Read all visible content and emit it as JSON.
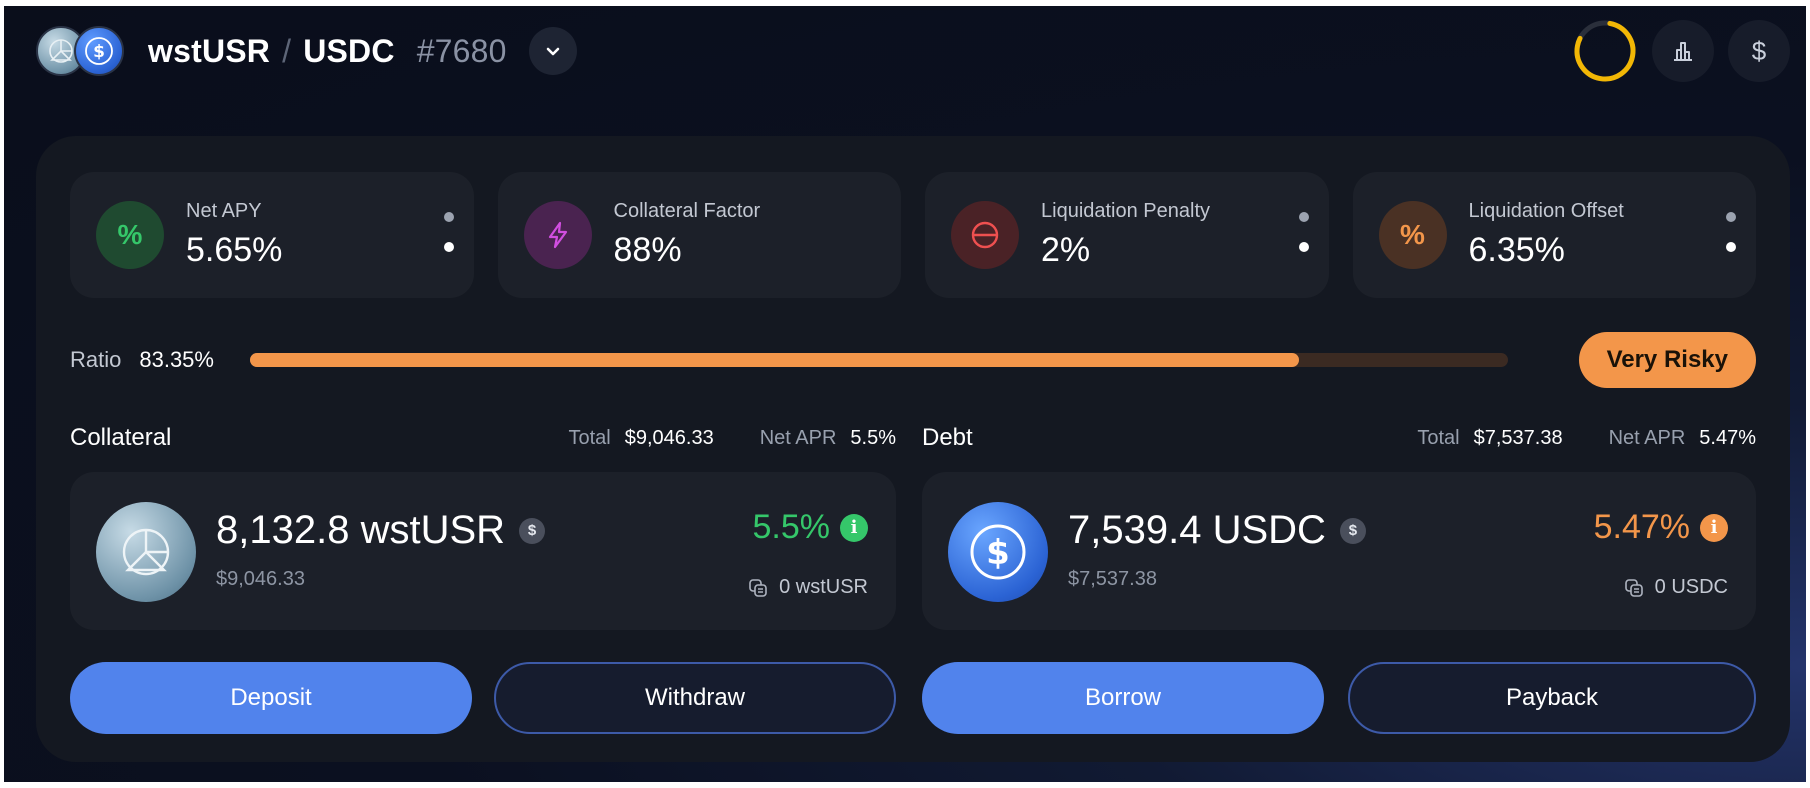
{
  "header": {
    "base_token": "wstUSR",
    "separator": "/",
    "quote_token": "USDC",
    "position_id": "#7680"
  },
  "stats": [
    {
      "label": "Net APY",
      "value": "5.65%",
      "icon": "percent-icon",
      "icon_color": "#35c76a",
      "icon_bg": "#1f4a30",
      "glyph": "%"
    },
    {
      "label": "Collateral Factor",
      "value": "88%",
      "icon": "lightning-icon",
      "icon_color": "#d14ee0",
      "icon_bg": "#4a2350"
    },
    {
      "label": "Liquidation Penalty",
      "value": "2%",
      "icon": "minus-circle-icon",
      "icon_color": "#ef5050",
      "icon_bg": "#4a2226"
    },
    {
      "label": "Liquidation Offset",
      "value": "6.35%",
      "icon": "percent-icon",
      "icon_color": "#f3964a",
      "icon_bg": "#4a3124",
      "glyph": "%"
    }
  ],
  "ratio": {
    "label": "Ratio",
    "value": "83.35%",
    "fill_fraction": 0.8335,
    "risk_label": "Very Risky",
    "risk_color": "#f3964a"
  },
  "collateral": {
    "title": "Collateral",
    "total_label": "Total",
    "total_value": "$9,046.33",
    "apr_label": "Net APR",
    "apr_value": "5.5%",
    "amount": "8,132.8 wstUSR",
    "usd": "$9,046.33",
    "rate": "5.5%",
    "rate_color": "#35c76a",
    "balance": "0 wstUSR"
  },
  "debt": {
    "title": "Debt",
    "total_label": "Total",
    "total_value": "$7,537.38",
    "apr_label": "Net APR",
    "apr_value": "5.47%",
    "amount": "7,539.4 USDC",
    "usd": "$7,537.38",
    "rate": "5.47%",
    "rate_color": "#f3964a",
    "balance": "0 USDC"
  },
  "actions": {
    "deposit": "Deposit",
    "withdraw": "Withdraw",
    "borrow": "Borrow",
    "payback": "Payback"
  },
  "icons": {
    "dollar_glyph": "$",
    "info_glyph": "i"
  },
  "colors": {
    "accent_blue": "#5183ec",
    "risk_orange": "#f3964a",
    "success_green": "#35c76a"
  }
}
